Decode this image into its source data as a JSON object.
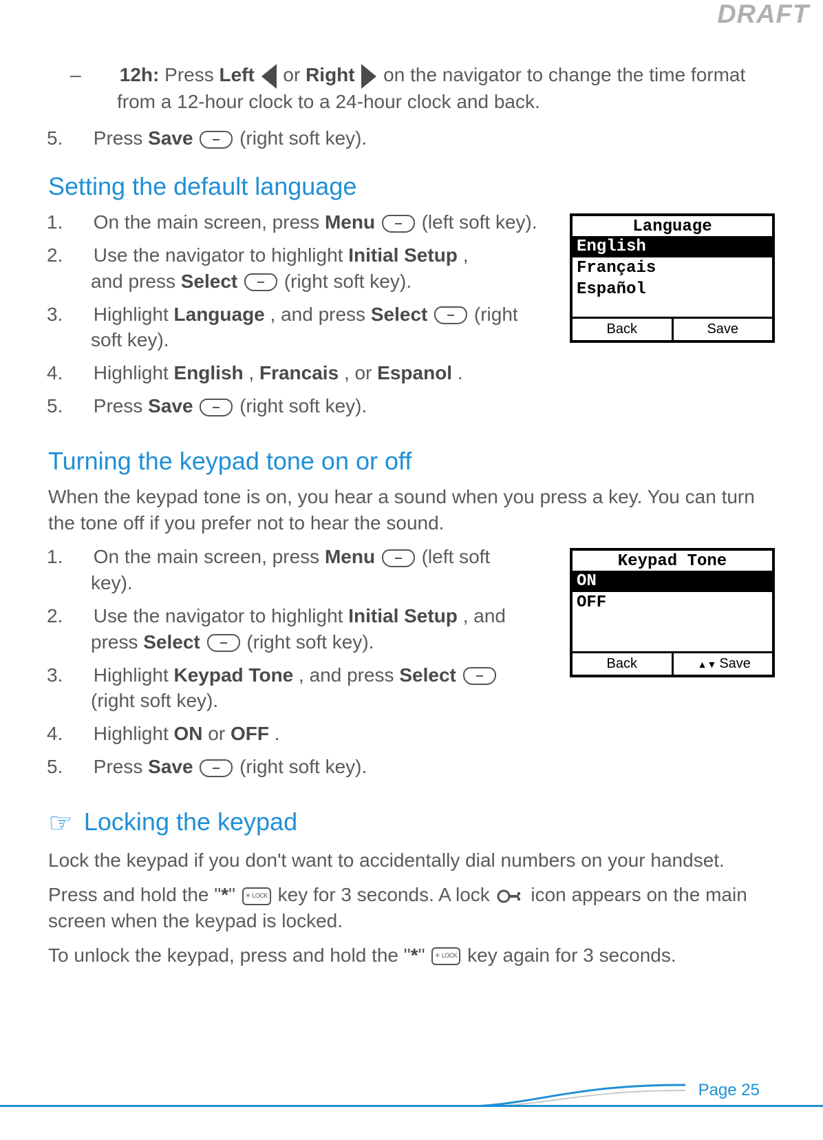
{
  "draft_label": "DRAFT",
  "intro": {
    "dash": "–",
    "twelve_h_label": "12h:",
    "twelve_h_text_a": "Press ",
    "left_label": "Left",
    "or_label": " or ",
    "right_label": "Right",
    "twelve_h_text_b": " on the navigator to change the time format from a 12-hour clock to a 24-hour clock and back."
  },
  "step5a": {
    "num": "5.",
    "text_a": "Press ",
    "save_label": "Save",
    "text_b": " (right soft key)."
  },
  "section1": {
    "heading": "Setting the default language",
    "s1": {
      "num": "1.",
      "a": "On the main screen, press ",
      "menu": "Menu",
      "b": " (left soft key)."
    },
    "s2": {
      "num": "2.",
      "a": "Use the navigator to highlight ",
      "init": "Initial Setup",
      "b": ", and press ",
      "sel": "Select",
      "c": " (right soft key)."
    },
    "s3": {
      "num": "3.",
      "a": "Highlight ",
      "lang": "Language",
      "b": ", and press ",
      "sel": "Select",
      "c": " (right soft key)."
    },
    "s4": {
      "num": "4.",
      "a": "Highlight ",
      "en": "English",
      "comma1": ", ",
      "fr": "Francais",
      "comma2": ", or ",
      "es": "Espanol",
      "dot": "."
    },
    "s5": {
      "num": "5.",
      "a": "Press ",
      "save": "Save",
      "b": "  (right soft key)."
    },
    "screen": {
      "title": "Language",
      "row1": "English",
      "row2": "Français",
      "row3": "Español",
      "back": "Back",
      "save": "Save"
    }
  },
  "section2": {
    "heading": "Turning the keypad tone on or off",
    "intro": "When the keypad tone is on, you hear a sound when you press a key. You can turn the tone off if you prefer not to hear the sound.",
    "s1": {
      "num": "1.",
      "a": "On the main screen, press ",
      "menu": "Menu",
      "b": " (left soft key)."
    },
    "s2": {
      "num": "2.",
      "a": "Use the navigator to highlight ",
      "init": "Initial Setup",
      "b": ", and press ",
      "sel": "Select",
      "c": " (right soft key)."
    },
    "s3": {
      "num": "3.",
      "a": "Highlight ",
      "kt": "Keypad Tone",
      "b": ", and press ",
      "sel": "Select",
      "c": " (right soft key)."
    },
    "s4": {
      "num": "4.",
      "a": "Highlight ",
      "on": "ON",
      "or": " or ",
      "off": "OFF",
      "dot": "."
    },
    "s5": {
      "num": "5.",
      "a": "Press ",
      "save": "Save",
      "b": "  (right soft key)."
    },
    "screen": {
      "title": "Keypad Tone",
      "row1": "ON",
      "row2": "OFF",
      "back": "Back",
      "save": "Save"
    }
  },
  "section3": {
    "heading": "Locking the keypad",
    "p1": "Lock the keypad if you don't want to accidentally dial numbers on your handset.",
    "p2a": "Press and hold the \"",
    "star": "*",
    "p2b": "\" ",
    "p2c": " key for 3 seconds. A lock ",
    "p2d": " icon appears on the main screen when the keypad is locked.",
    "p3a": "To unlock the keypad, press and hold the \"",
    "p3b": "\" ",
    "p3c": " key again for 3 seconds."
  },
  "page_label": "Page 25"
}
